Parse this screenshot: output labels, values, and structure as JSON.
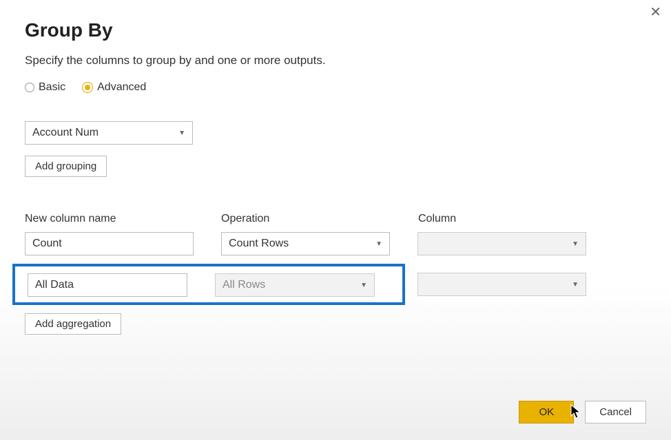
{
  "dialog": {
    "title": "Group By",
    "description": "Specify the columns to group by and one or more outputs.",
    "close_icon": "✕"
  },
  "mode": {
    "basic_label": "Basic",
    "advanced_label": "Advanced",
    "selected": "Advanced"
  },
  "grouping": {
    "dropdown_value": "Account Num",
    "add_button_label": "Add grouping"
  },
  "columns_header": {
    "name": "New column name",
    "operation": "Operation",
    "column": "Column"
  },
  "aggregations": [
    {
      "name_value": "Count",
      "operation_value": "Count Rows",
      "column_value": "",
      "column_disabled": true,
      "highlighted": false
    },
    {
      "name_value": "All Data",
      "operation_value": "All Rows",
      "column_value": "",
      "column_disabled": true,
      "highlighted": true
    }
  ],
  "add_aggregation_label": "Add aggregation",
  "footer": {
    "ok_label": "OK",
    "cancel_label": "Cancel"
  }
}
